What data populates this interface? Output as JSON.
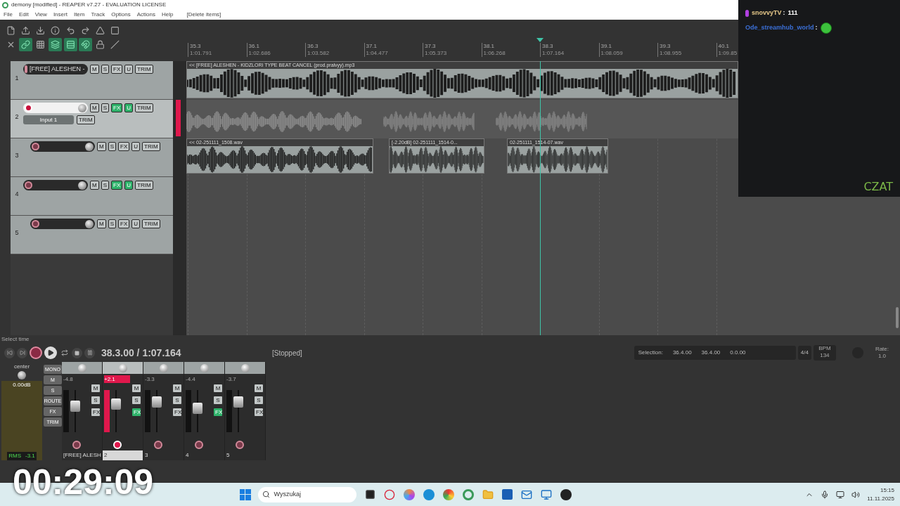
{
  "window": {
    "title": "demony [modified] - REAPER v7.27 - EVALUATION LICENSE"
  },
  "menu": [
    "File",
    "Edit",
    "View",
    "Insert",
    "Item",
    "Track",
    "Options",
    "Actions",
    "Help",
    "[Delete items]"
  ],
  "toolbar": [
    {
      "on": false
    },
    {
      "on": false
    },
    {
      "on": false
    },
    {
      "on": false
    },
    {
      "on": false
    },
    {
      "on": false
    },
    {
      "on": false
    },
    {
      "on": false
    },
    {
      "on": false
    },
    {
      "on": true
    },
    {
      "on": false
    },
    {
      "on": true
    },
    {
      "on": true
    },
    {
      "on": true
    },
    {
      "on": false
    },
    {
      "on": false
    }
  ],
  "ruler": [
    {
      "bar": "35.3",
      "time": "1:01.791"
    },
    {
      "bar": "36.1",
      "time": "1:02.686"
    },
    {
      "bar": "36.3",
      "time": "1:03.582"
    },
    {
      "bar": "37.1",
      "time": "1:04.477"
    },
    {
      "bar": "37.3",
      "time": "1:05.373"
    },
    {
      "bar": "38.1",
      "time": "1:06.268"
    },
    {
      "bar": "38.3",
      "time": "1:07.164"
    },
    {
      "bar": "39.1",
      "time": "1:08.059"
    },
    {
      "bar": "39.3",
      "time": "1:08.955"
    },
    {
      "bar": "40.1",
      "time": "1:09.85"
    }
  ],
  "tracks": [
    {
      "number": "1",
      "name": "[FREE] ALESHEN -",
      "selected": false,
      "armed": false,
      "fx_on": false,
      "buttons": [
        "M",
        "S",
        "FX",
        "U",
        "TRIM"
      ],
      "items": [
        "<< [FREE] ALESHEN - KIDZLORI TYPE BEAT CANCEL (prod.pralvyy).mp3"
      ]
    },
    {
      "number": "2",
      "input": "Input 1",
      "input_trim": "TRIM",
      "selected": true,
      "armed": true,
      "fx_on": true,
      "buttons": [
        "M",
        "S",
        "FX",
        "U",
        "TRIM"
      ]
    },
    {
      "number": "3",
      "selected": false,
      "armed": false,
      "fx_on": false,
      "buttons": [
        "M",
        "S",
        "FX",
        "U",
        "TRIM"
      ],
      "items": [
        "<< 02-251111_1508.wav",
        "[-2.20dB] 02-251111_1514-0...",
        "02-251111_1514-07.wav"
      ]
    },
    {
      "number": "4",
      "selected": false,
      "armed": false,
      "fx_on": true,
      "buttons": [
        "M",
        "S",
        "FX",
        "U",
        "TRIM"
      ]
    },
    {
      "number": "5",
      "selected": false,
      "armed": false,
      "fx_on": false,
      "buttons": [
        "M",
        "S",
        "FX",
        "U",
        "TRIM"
      ]
    }
  ],
  "status": "Select time",
  "transport": {
    "position": "38.3.00 / 1:07.164",
    "state": "[Stopped]",
    "selection_label": "Selection:",
    "selection_start": "36.4.00",
    "selection_end": "36.4.00",
    "selection_length": "0.0.00",
    "time_signature": "4/4",
    "bpm_label": "BPM",
    "bpm": "134",
    "rate_label": "Rate:",
    "rate": "1.0"
  },
  "master": {
    "pan": "center",
    "volume": "0.00dB",
    "rms": "RMS",
    "peak": "-3.1",
    "buttons": [
      "MONO",
      "M",
      "S",
      "ROUTE",
      "FX",
      "TRIM"
    ]
  },
  "mixer": [
    {
      "volume": "-4.8",
      "label": "[FREE] ALESH",
      "selected": false,
      "armed": false,
      "fx_on": false,
      "level": 0.62,
      "buttons": [
        "M",
        "S",
        "FX"
      ]
    },
    {
      "volume": "+2.1",
      "label": "2",
      "selected": true,
      "armed": true,
      "fx_on": true,
      "level": 0.66,
      "buttons": [
        "M",
        "S",
        "FX"
      ]
    },
    {
      "volume": "-3.3",
      "label": "3",
      "selected": false,
      "armed": false,
      "fx_on": false,
      "level": 0.72,
      "buttons": [
        "M",
        "S",
        "FX"
      ]
    },
    {
      "volume": "-4.4",
      "label": "4",
      "selected": false,
      "armed": false,
      "fx_on": true,
      "level": 0.56,
      "buttons": [
        "M",
        "S",
        "FX"
      ]
    },
    {
      "volume": "-3.7",
      "label": "5",
      "selected": false,
      "armed": false,
      "fx_on": false,
      "level": 0.72,
      "buttons": [
        "M",
        "S",
        "FX"
      ]
    }
  ],
  "chat": {
    "messages": [
      {
        "user": "snovvyTV",
        "colon": ":",
        "text": "111",
        "color": "#e8c98a",
        "emote": false
      },
      {
        "user": "Ode_streamhub_world",
        "colon": ":",
        "color": "#3b6fd6",
        "emote": true
      }
    ],
    "footer": "CZAT"
  },
  "timer": "00:29:09",
  "taskbar": {
    "search": "Wyszukaj",
    "time": "15:15",
    "date": "11.11.2025"
  }
}
